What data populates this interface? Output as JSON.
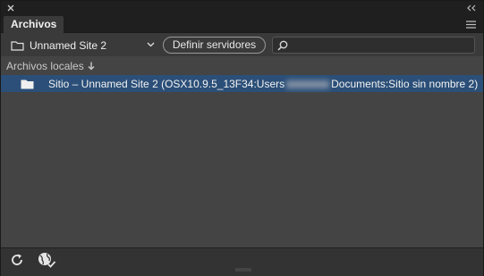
{
  "panel": {
    "tab_label": "Archivos"
  },
  "toolbar": {
    "site_name": "Unnamed Site 2",
    "define_servers_label": "Definir servidores",
    "search_placeholder": ""
  },
  "content": {
    "column_header": "Archivos locales",
    "row_prefix": "Sitio – Unnamed Site 2 (OSX10.9.5_13F34:Users",
    "row_suffix": "Documents:Sitio sin nombre 2)"
  },
  "icons": {
    "close": "close-icon",
    "collapse": "double-chevron-icon",
    "menu": "hamburger-menu-icon",
    "folder": "folder-icon",
    "chevron": "chevron-down-icon",
    "search": "search-icon",
    "sort": "arrow-down-icon",
    "refresh": "refresh-icon",
    "sync": "globe-sync-icon"
  },
  "colors": {
    "selection": "#2b4f78",
    "content_bg": "#444444",
    "toolbar_bg": "#3a3a3a"
  }
}
